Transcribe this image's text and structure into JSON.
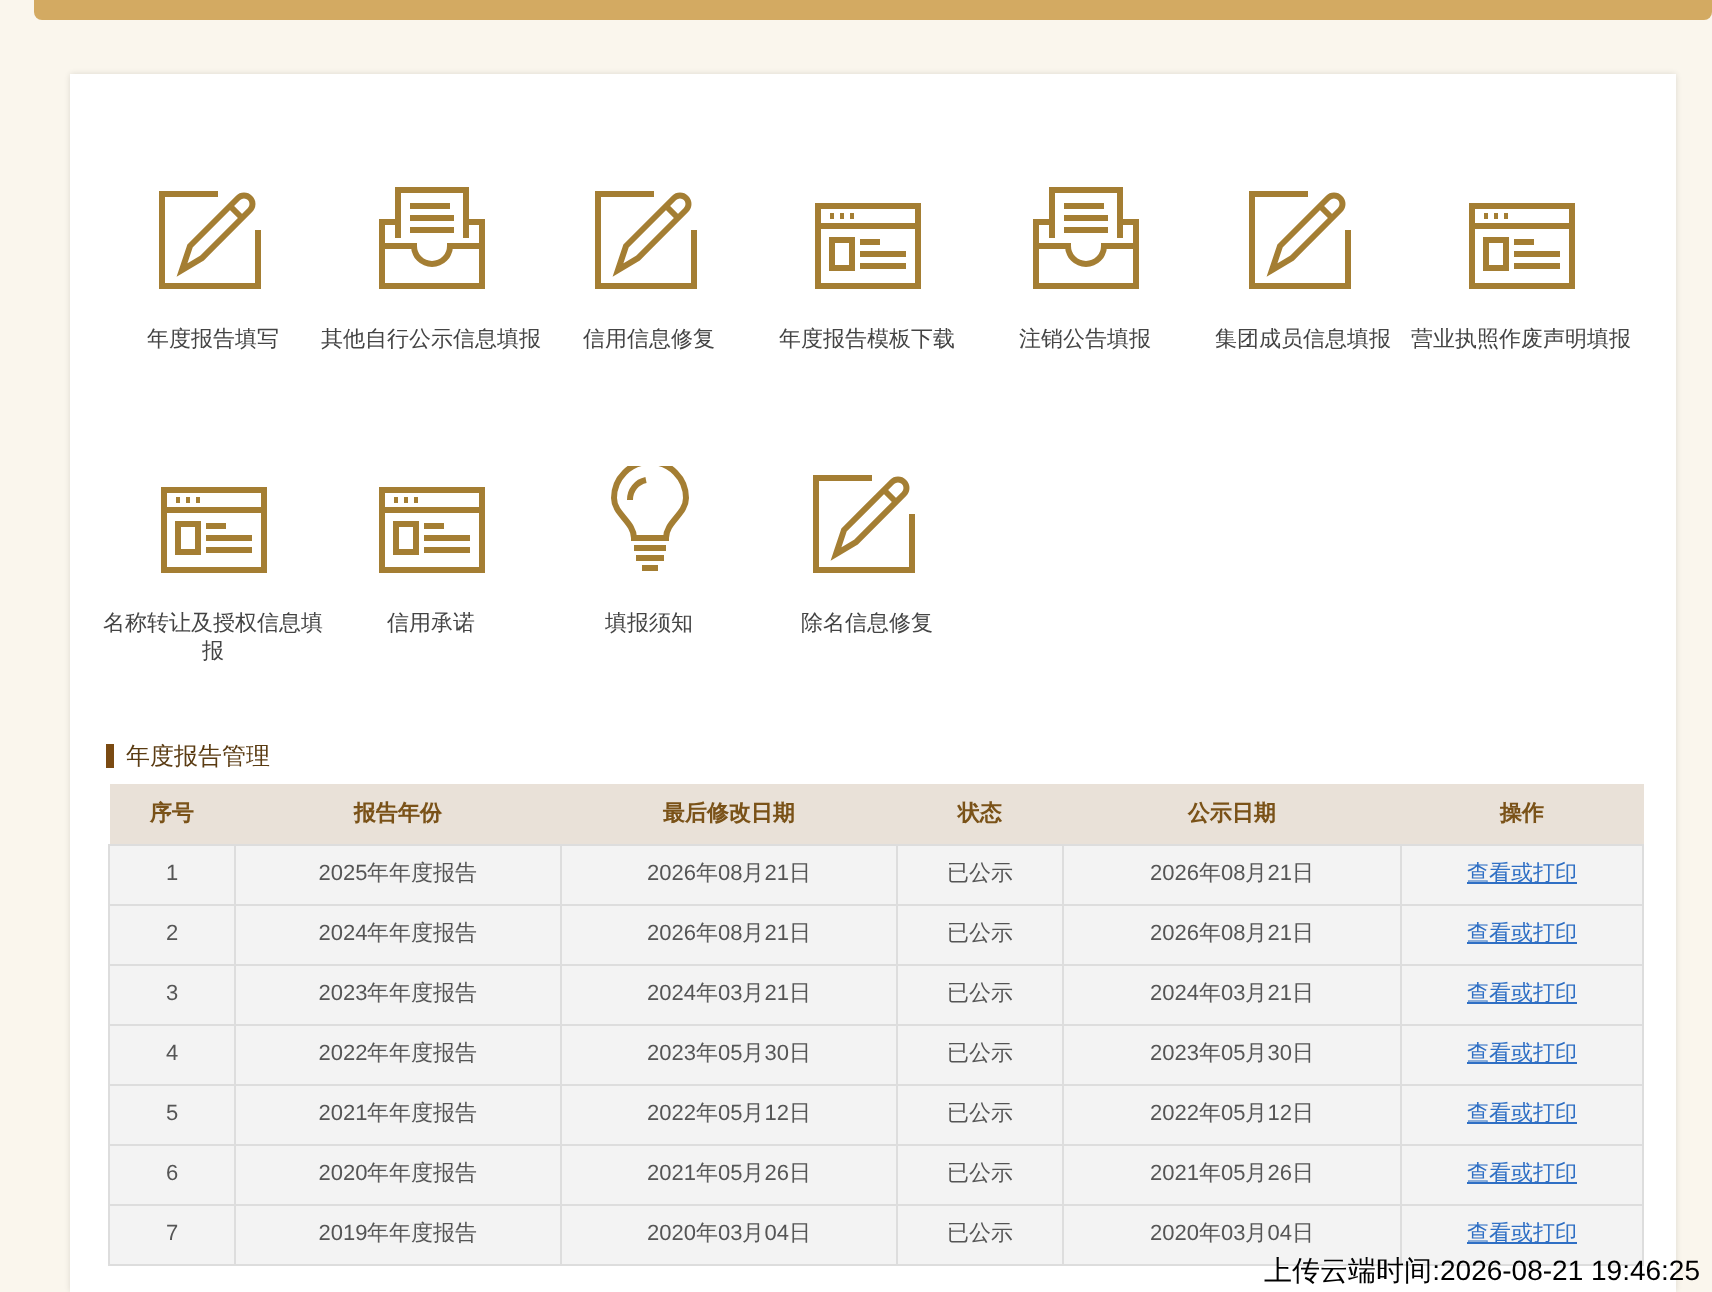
{
  "tiles": [
    {
      "label": "年度报告填写",
      "kind": "edit"
    },
    {
      "label": "其他自行公示信息填报",
      "kind": "tray"
    },
    {
      "label": "信用信息修复",
      "kind": "edit"
    },
    {
      "label": "年度报告模板下载",
      "kind": "form"
    },
    {
      "label": "注销公告填报",
      "kind": "tray"
    },
    {
      "label": "集团成员信息填报",
      "kind": "edit"
    },
    {
      "label": "营业执照作废声明填报",
      "kind": "form"
    },
    {
      "label": "名称转让及授权信息填报",
      "kind": "form"
    },
    {
      "label": "信用承诺",
      "kind": "form"
    },
    {
      "label": "填报须知",
      "kind": "bulb"
    },
    {
      "label": "除名信息修复",
      "kind": "edit"
    }
  ],
  "section_title": "年度报告管理",
  "table": {
    "columns": [
      "序号",
      "报告年份",
      "最后修改日期",
      "状态",
      "公示日期",
      "操作"
    ],
    "rows": [
      [
        "1",
        "2025年年度报告",
        "2026年08月21日",
        "已公示",
        "2026年08月21日",
        "查看或打印"
      ],
      [
        "2",
        "2024年年度报告",
        "2026年08月21日",
        "已公示",
        "2026年08月21日",
        "查看或打印"
      ],
      [
        "3",
        "2023年年度报告",
        "2024年03月21日",
        "已公示",
        "2024年03月21日",
        "查看或打印"
      ],
      [
        "4",
        "2022年年度报告",
        "2023年05月30日",
        "已公示",
        "2023年05月30日",
        "查看或打印"
      ],
      [
        "5",
        "2021年年度报告",
        "2022年05月12日",
        "已公示",
        "2022年05月12日",
        "查看或打印"
      ],
      [
        "6",
        "2020年年度报告",
        "2021年05月26日",
        "已公示",
        "2021年05月26日",
        "查看或打印"
      ],
      [
        "7",
        "2019年年度报告",
        "2020年03月04日",
        "已公示",
        "2020年03月04日",
        "查看或打印"
      ]
    ]
  },
  "upload_stamp": "上传云端时间:2026-08-21 19:46:25"
}
